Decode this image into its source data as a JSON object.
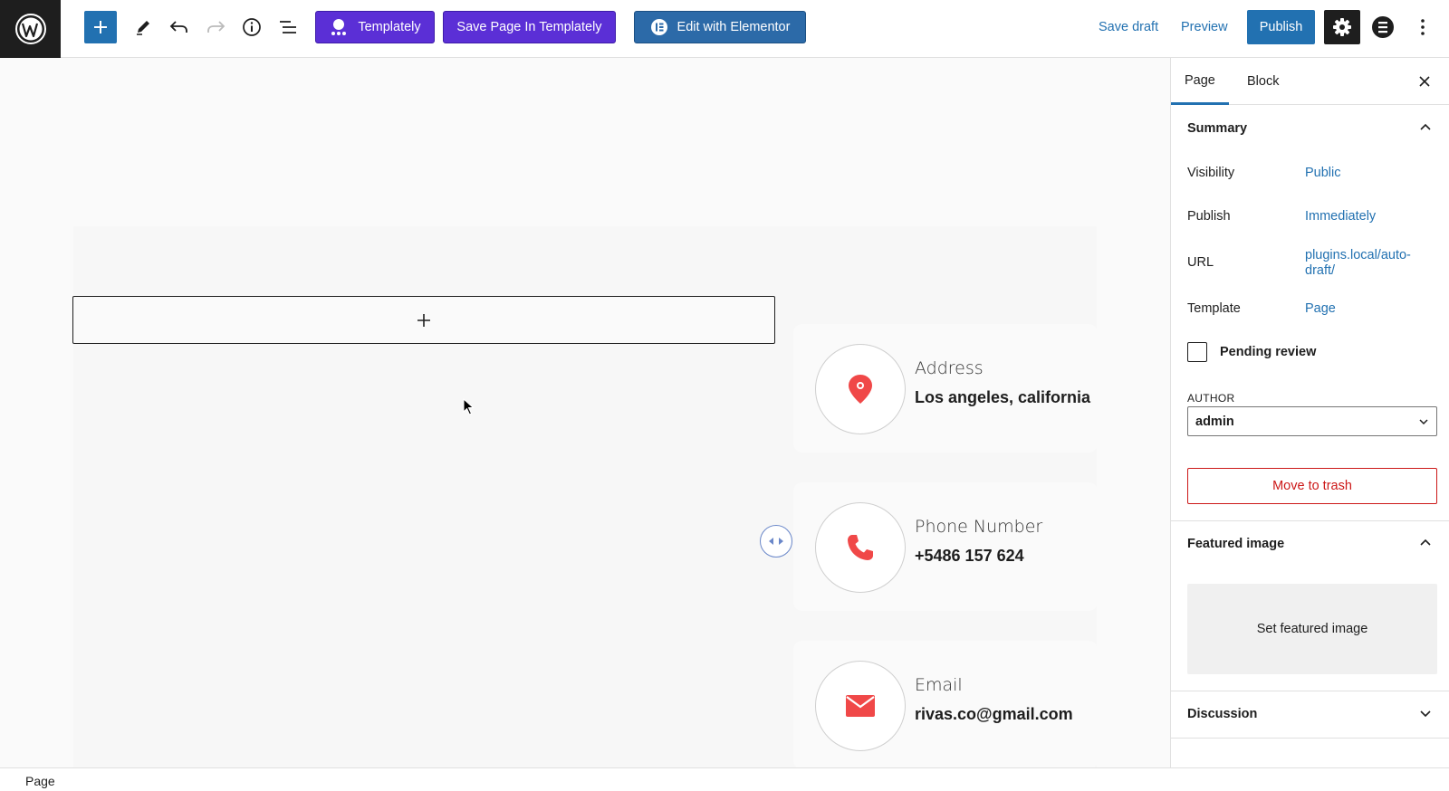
{
  "toolbar": {
    "templately_label": "Templately",
    "save_templately_label": "Save Page In Templately",
    "elementor_label": "Edit with Elementor",
    "save_draft": "Save draft",
    "preview": "Preview",
    "publish": "Publish"
  },
  "canvas": {
    "cards": [
      {
        "title": "Address",
        "value": "Los angeles, california",
        "icon": "map-pin-icon"
      },
      {
        "title": "Phone Number",
        "value": "+5486 157 624",
        "icon": "phone-icon"
      },
      {
        "title": "Email",
        "value": "rivas.co@gmail.com",
        "icon": "envelope-icon"
      }
    ]
  },
  "sidebar": {
    "tabs": [
      "Page",
      "Block"
    ],
    "summary": {
      "heading": "Summary",
      "visibility_label": "Visibility",
      "visibility_value": "Public",
      "publish_label": "Publish",
      "publish_value": "Immediately",
      "url_label": "URL",
      "url_value_line1": "plugins.local/auto-",
      "url_value_line2": "draft/",
      "template_label": "Template",
      "template_value": "Page",
      "pending_review": "Pending review",
      "author_label": "AUTHOR",
      "author_value": "admin",
      "trash": "Move to trash"
    },
    "featured": {
      "heading": "Featured image",
      "set_label": "Set featured image"
    },
    "discussion": {
      "heading": "Discussion"
    }
  },
  "footer": {
    "breadcrumb": "Page"
  },
  "colors": {
    "accent": "#2271b1",
    "templately_purple": "#5b2fd6",
    "elementor_blue": "#2c6aa8",
    "icon_red": "#f04848",
    "danger": "#cc1818"
  }
}
